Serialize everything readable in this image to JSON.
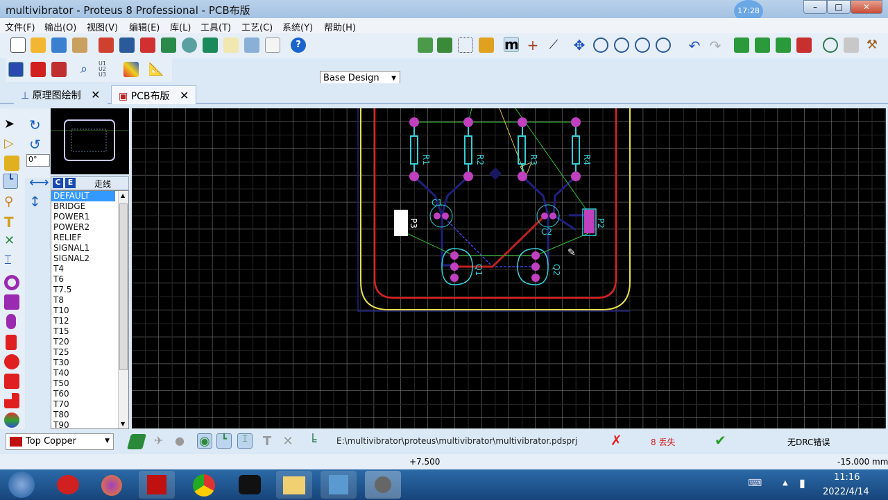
{
  "window": {
    "title": "multivibrator - Proteus 8 Professional - PCB布版",
    "clock_bubble": "17:28"
  },
  "menu": [
    "文件(F)",
    "输出(O)",
    "视图(V)",
    "编辑(E)",
    "库(L)",
    "工具(T)",
    "工艺(C)",
    "系统(Y)",
    "帮助(H)"
  ],
  "toolbar": {
    "design_variant": "Base Design",
    "u_labels": "U1 U2 U3"
  },
  "tabs": [
    {
      "label": "原理图绘制"
    },
    {
      "label": "PCB布版"
    }
  ],
  "left_panel": {
    "rotation": "0°",
    "mode_c": "C",
    "mode_e": "E",
    "panel_title": "走线",
    "styles": [
      "DEFAULT",
      "BRIDGE",
      "POWER1",
      "POWER2",
      "RELIEF",
      "SIGNAL1",
      "SIGNAL2",
      "T4",
      "T6",
      "T7.5",
      "T8",
      "T10",
      "T12",
      "T15",
      "T20",
      "T25",
      "T30",
      "T40",
      "T50",
      "T60",
      "T70",
      "T80",
      "T90"
    ],
    "selected": "DEFAULT"
  },
  "pcb": {
    "components": [
      "R1",
      "R2",
      "R3",
      "R4",
      "C1",
      "C2",
      "Q1",
      "Q2",
      "P2",
      "P3"
    ],
    "colors": {
      "board_edge": "#e8e04a",
      "keepout": "#e02020",
      "silk": "#33d0d8",
      "pad": "#c040c0",
      "ratsnest": "#30c030",
      "trace_bottom": "#202080",
      "trace_top": "#c02020"
    }
  },
  "status": {
    "layer": "Top Copper",
    "project_path": "E:\\multivibrator\\proteus\\multivibrator\\multivibrator.pdsprj",
    "missing": "8 丢失",
    "drc": "无DRC错误",
    "coord_x": "+7.500",
    "coord_y": "-15.000",
    "unit": "mm"
  },
  "taskbar": {
    "time": "11:16",
    "date": "2022/4/14"
  }
}
